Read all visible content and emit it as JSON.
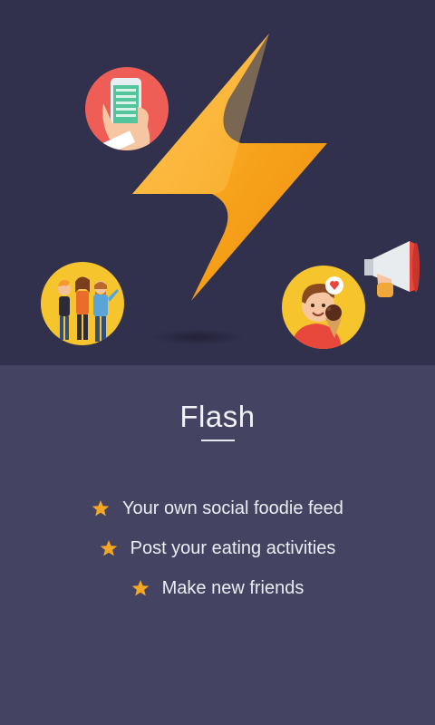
{
  "screen": {
    "title": "Flash",
    "features": [
      {
        "icon": "star-icon",
        "label": "Your own social foodie feed"
      },
      {
        "icon": "star-icon",
        "label": "Post your eating activities"
      },
      {
        "icon": "star-icon",
        "label": "Make new friends"
      }
    ]
  },
  "colors": {
    "hero_background": "#32314d",
    "content_background": "#444462",
    "accent_star": "#f5a623",
    "bolt": "#f7a21b"
  },
  "illustrations": [
    "phone-in-hand-icon",
    "friends-group-icon",
    "megaphone-icon",
    "ice-cream-boy-icon",
    "lightning-bolt-icon"
  ]
}
